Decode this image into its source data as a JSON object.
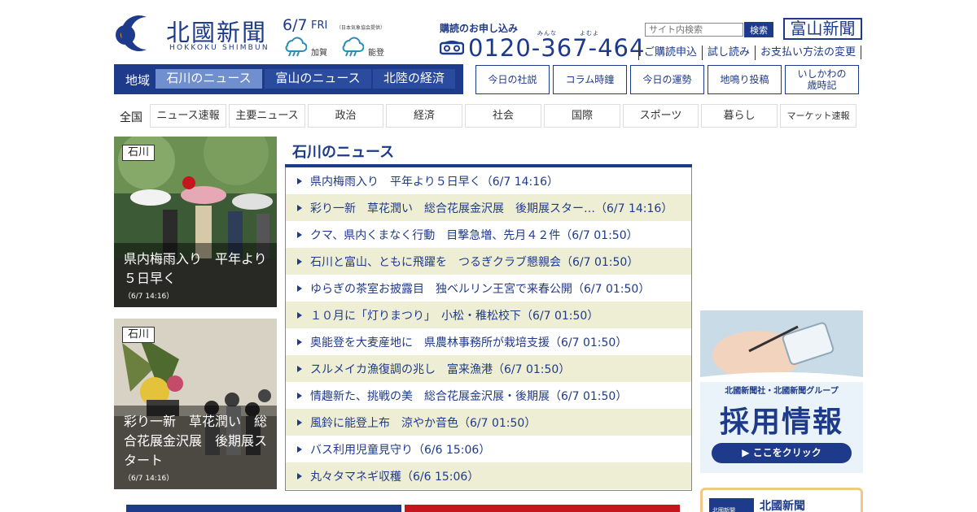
{
  "brand": {
    "logo_main": "北國新聞",
    "logo_sub": "HOKKOKU SHIMBUN",
    "toyama_logo": "富山新聞"
  },
  "date": {
    "day": "6/7",
    "weekday": "FRI",
    "credit": "（日本気象協会提供）",
    "weather": [
      {
        "area": "加賀",
        "icon": "rain-icon"
      },
      {
        "area": "能登",
        "icon": "rain-icon"
      }
    ]
  },
  "subscribe": {
    "title": "購読のお申し込み",
    "ruby": [
      "みんな",
      "よむよ"
    ],
    "phone": "0120-367-464"
  },
  "search": {
    "placeholder": "サイト内検索",
    "button": "検索"
  },
  "util_links": [
    "ご購読申込",
    "試し読み",
    "お支払い方法の変更"
  ],
  "region_nav": {
    "label": "地域",
    "tabs": [
      "石川のニュース",
      "富山のニュース",
      "北陸の経済"
    ]
  },
  "feature_buttons": [
    "今日の社説",
    "コラム時鐘",
    "今日の運勢",
    "地鳴り投稿",
    "いしかわの\n歳時記"
  ],
  "categories": {
    "all": "全国",
    "items": [
      "ニュース速報",
      "主要ニュース",
      "政治",
      "経済",
      "社会",
      "国際",
      "スポーツ",
      "暮らし",
      "マーケット速報"
    ]
  },
  "photo_cards": [
    {
      "tag": "石川",
      "caption": "県内梅雨入り　平年より５日早く",
      "time": "（6/7 14:16）"
    },
    {
      "tag": "石川",
      "caption": "彩り一新　草花潤い　総合花展金沢展　後期展スタート",
      "time": "（6/7 14:16）"
    }
  ],
  "news": {
    "title": "石川のニュース",
    "items": [
      "県内梅雨入り　平年より５日早く（6/7 14:16）",
      "彩り一新　草花潤い　総合花展金沢展　後期展スター…（6/7 14:16）",
      "クマ、県内くまなく行動　目撃急増、先月４２件（6/7 01:50）",
      "石川と富山、ともに飛躍を　つるぎクラブ懇親会（6/7 01:50）",
      "ゆらぎの茶室お披露目　独ベルリン王宮で来春公開（6/7 01:50）",
      "１０月に「灯りまつり」　小松・稚松校下（6/7 01:50）",
      "奥能登を大麦産地に　県農林事務所が栽培支援（6/7 01:50）",
      "スルメイカ漁復調の兆し　富来漁港（6/7 01:50）",
      "情趣新た、挑戦の美　総合花展金沢展・後期展（6/7 01:50）",
      "風鈴に能登上布　涼やか音色（6/7 01:50）",
      "バス利用児童見守り（6/6 15:06）",
      "丸々タマネギ収穫（6/6 15:06）"
    ]
  },
  "recruit_banner": {
    "sub": "北國新聞社・北國新聞グループ",
    "main": "採用情報",
    "button": "▶ ここをクリック"
  },
  "side_box": {
    "icon_text": "北國新聞",
    "title": "北國新聞"
  },
  "colors": {
    "brand_navy": "#1e3a8a",
    "active_tab": "#6f8fcf",
    "row_alt": "#eeeed5",
    "accent_orange": "#f2c889"
  }
}
